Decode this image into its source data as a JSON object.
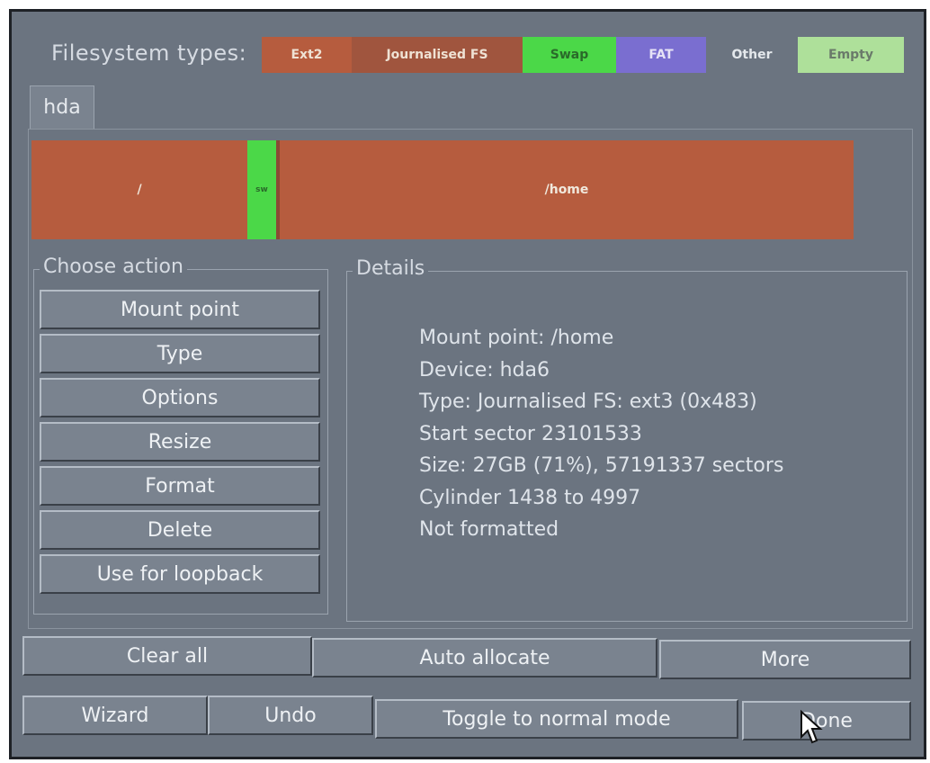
{
  "legend": {
    "title": "Filesystem types:",
    "items": [
      {
        "label": "Ext2",
        "color": "#b65c3e",
        "text_color": "#efe2d4"
      },
      {
        "label": "Journalised FS",
        "color": "#a0553e",
        "text_color": "#efe2d4"
      },
      {
        "label": "Swap",
        "color": "#4bd848",
        "text_color": "#2a6a2a"
      },
      {
        "label": "FAT",
        "color": "#7a6ed0",
        "text_color": "#e6e2f6"
      },
      {
        "label": "Other",
        "color": "#6b7480",
        "text_color": "#e4e8ec"
      },
      {
        "label": "Empty",
        "color": "#aee09a",
        "text_color": "#6a7a6a"
      }
    ]
  },
  "tab": {
    "label": "hda"
  },
  "partitions": [
    {
      "label": "/",
      "type": "Ext2"
    },
    {
      "label": "sw",
      "type": "Swap"
    },
    {
      "label": "/home",
      "type": "Journalised FS"
    }
  ],
  "actions": {
    "title": "Choose action",
    "buttons": [
      "Mount point",
      "Type",
      "Options",
      "Resize",
      "Format",
      "Delete",
      "Use for loopback"
    ]
  },
  "details": {
    "title": "Details",
    "lines": [
      "Mount point: /home",
      "Device: hda6",
      "Type: Journalised FS: ext3 (0x483)",
      "Start sector 23101533",
      "Size: 27GB (71%), 57191337 sectors",
      "Cylinder 1438 to 4997",
      "Not formatted"
    ]
  },
  "buttons_row1": {
    "clear_all": "Clear all",
    "auto_allocate": "Auto allocate",
    "more": "More"
  },
  "buttons_row2": {
    "wizard": "Wizard",
    "undo": "Undo",
    "toggle": "Toggle to normal mode",
    "done": "Done"
  }
}
